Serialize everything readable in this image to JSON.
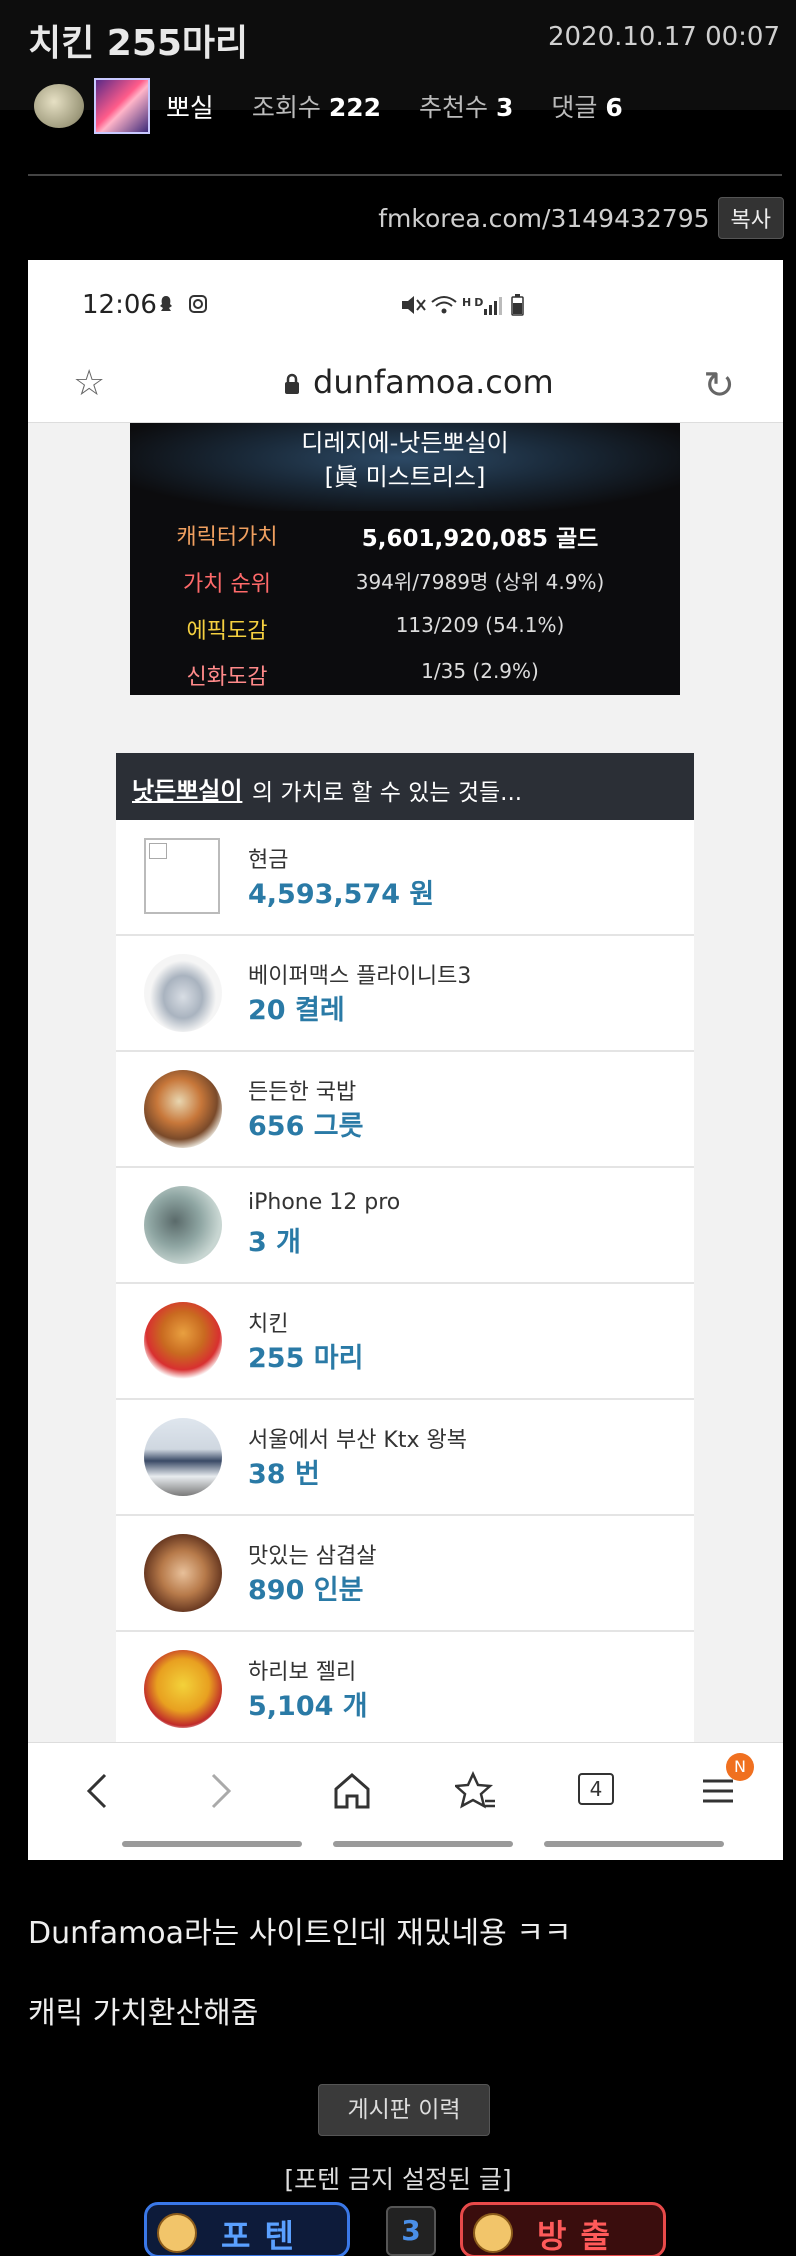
{
  "post": {
    "title": "치킨 255마리",
    "date": "2020.10.17 00:07",
    "author": "뽀실",
    "views_label": "조회수",
    "views": "222",
    "recommends_label": "추천수",
    "recommends": "3",
    "comments_label": "댓글",
    "comments": "6",
    "url": "fmkorea.com/3149432795",
    "copy_label": "복사"
  },
  "phone": {
    "status": {
      "time": "12:06"
    },
    "address": {
      "domain": "dunfamoa.com"
    },
    "character": {
      "name": "디레지에-낫든뽀실이",
      "title": "[眞 미스트리스]",
      "rows": [
        {
          "label": "캐릭터가치",
          "value": "5,601,920,085 골드",
          "color": "#f0a060"
        },
        {
          "label": "가치 순위",
          "value": "394위/7989명 (상위 4.9%)",
          "color": "#ff6a6a"
        },
        {
          "label": "에픽도감",
          "value": "113/209 (54.1%)",
          "color": "#f5d040"
        },
        {
          "label": "신화도감",
          "value": "1/35 (2.9%)",
          "color": "#ff8a8a"
        }
      ]
    },
    "list": {
      "header_name": "낫든뽀실이",
      "header_rest": "의 가치로 할 수 있는 것들...",
      "items": [
        {
          "name": "현금",
          "value": "4,593,574 원",
          "icon": "broken-image"
        },
        {
          "name": "베이퍼맥스 플라이니트3",
          "value": "20 켤레",
          "icon": "sneaker-icon"
        },
        {
          "name": "든든한 국밥",
          "value": "656 그릇",
          "icon": "gukbap-icon"
        },
        {
          "name": "iPhone 12 pro",
          "value": "3 개",
          "icon": "iphone-icon"
        },
        {
          "name": "치킨",
          "value": "255 마리",
          "icon": "chicken-icon"
        },
        {
          "name": "서울에서 부산 Ktx 왕복",
          "value": "38 번",
          "icon": "ktx-train-icon"
        },
        {
          "name": "맛있는 삼겹살",
          "value": "890 인분",
          "icon": "samgyeopsal-icon"
        },
        {
          "name": "하리보 젤리",
          "value": "5,104 개",
          "icon": "haribo-icon"
        }
      ]
    },
    "nav": {
      "tabs_count": "4",
      "badge": "N"
    }
  },
  "body": {
    "line1": "Dunfamoa라는 사이트인데 재밌네용 ㅋㅋ",
    "line2": "캐릭 가치환산해줌",
    "history_label": "게시판 이력",
    "pote_note": "[포텐 금지 설정된 글]",
    "vote_up": "포텐",
    "vote_count": "3",
    "vote_down": "방출"
  }
}
